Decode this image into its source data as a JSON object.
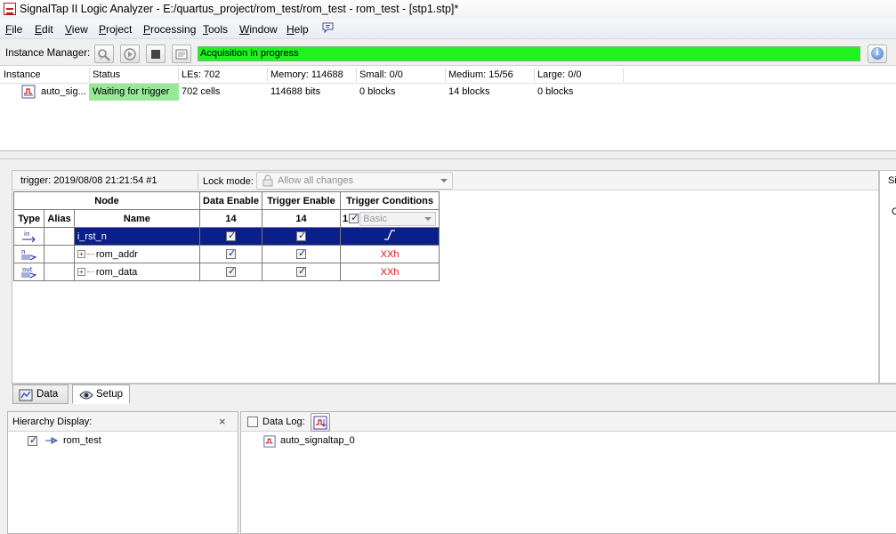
{
  "window": {
    "title": "SignalTap II Logic Analyzer - E:/quartus_project/rom_test/rom_test - rom_test - [stp1.stp]*"
  },
  "menu": {
    "items": [
      {
        "label": "File",
        "key": "F",
        "rest": "ile"
      },
      {
        "label": "Edit",
        "key": "E",
        "rest": "dit"
      },
      {
        "label": "View",
        "key": "V",
        "rest": "iew"
      },
      {
        "label": "Project",
        "key": "P",
        "rest": "roject"
      },
      {
        "label": "Processing",
        "key": "P",
        "rest": "rocessing"
      },
      {
        "label": "Tools",
        "key": "T",
        "rest": "ools"
      },
      {
        "label": "Window",
        "key": "W",
        "rest": "indow"
      },
      {
        "label": "Help",
        "key": "H",
        "rest": "elp"
      }
    ],
    "help_icon": "whats-this-icon"
  },
  "instance_manager": {
    "label": "Instance Manager:",
    "toolbar_icons": [
      "autorun-analysis-icon",
      "run-analysis-icon",
      "stop-analysis-icon",
      "read-data-icon"
    ],
    "status_text": "Acquisition in progress",
    "status_color": "#21f121",
    "info_icon": "info-icon"
  },
  "instance_table": {
    "headers": {
      "instance": "Instance",
      "status": "Status",
      "les": "LEs: 702",
      "memory": "Memory: 114688",
      "small": "Small: 0/0",
      "medium": "Medium: 15/56",
      "large": "Large: 0/0"
    },
    "row": {
      "instance": "auto_sig...",
      "status": "Waiting for trigger",
      "les": "702 cells",
      "memory": "114688 bits",
      "small": "0 blocks",
      "medium": "14 blocks",
      "large": "0 blocks"
    },
    "status_color": "#98e898"
  },
  "setup": {
    "trigger_info": "trigger: 2019/08/08 21:21:54  #1",
    "lock_mode_label": "Lock mode:",
    "lock_mode_value": "Allow all changes",
    "right_pane_text_1": "Si",
    "right_pane_text_2": "C",
    "table": {
      "group_headers": {
        "node": "Node",
        "data_enable": "Data Enable",
        "trigger_enable": "Trigger Enable",
        "trigger_conditions": "Trigger Conditions"
      },
      "sub_headers": {
        "type": "Type",
        "alias": "Alias",
        "name": "Name",
        "data_enable_count": "14",
        "trigger_enable_count": "14",
        "trigger_cond_index": "1",
        "trigger_cond_mode": "Basic"
      },
      "rows": [
        {
          "type_label": "in",
          "name": "i_rst_n",
          "condition": "rising-edge",
          "selected": true
        },
        {
          "type_label": "n",
          "name": "rom_addr",
          "condition": "XXh",
          "selected": false
        },
        {
          "type_label": "out",
          "name": "rom_data",
          "condition": "XXh",
          "selected": false
        }
      ]
    }
  },
  "tabs": [
    {
      "label": "Data",
      "active": false
    },
    {
      "label": "Setup",
      "active": true
    }
  ],
  "hierarchy": {
    "title": "Hierarchy Display:",
    "close_label": "×",
    "item": "rom_test"
  },
  "data_log": {
    "label": "Data Log:",
    "item": "auto_signaltap_0"
  }
}
